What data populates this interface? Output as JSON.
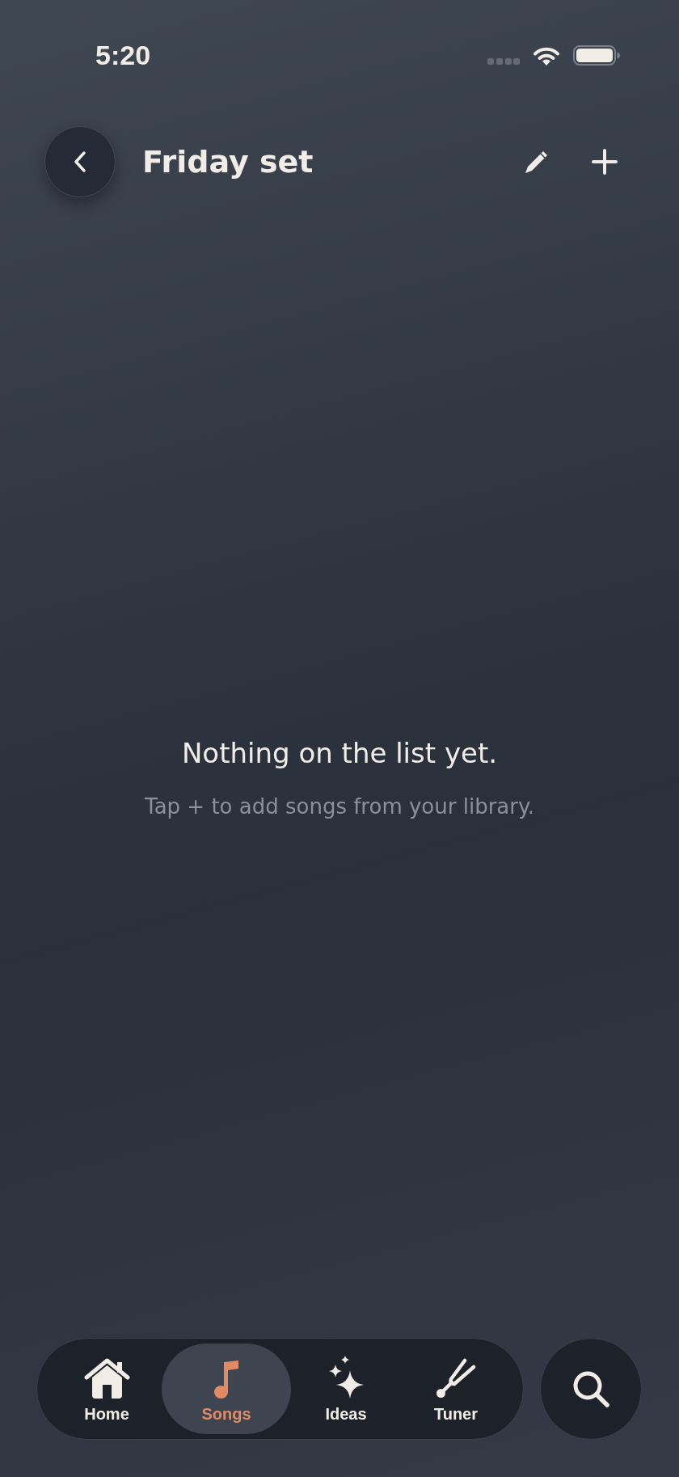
{
  "status_bar": {
    "time": "5:20"
  },
  "header": {
    "title": "Friday set"
  },
  "empty_state": {
    "title": "Nothing on the list yet.",
    "message": "Tap + to add songs from your library."
  },
  "tab_bar": {
    "tabs": [
      {
        "label": "Home",
        "kind": "home",
        "selected": false
      },
      {
        "label": "Songs",
        "kind": "songs",
        "selected": true
      },
      {
        "label": "Ideas",
        "kind": "ideas",
        "selected": false
      },
      {
        "label": "Tuner",
        "kind": "tuner",
        "selected": false
      }
    ]
  }
}
